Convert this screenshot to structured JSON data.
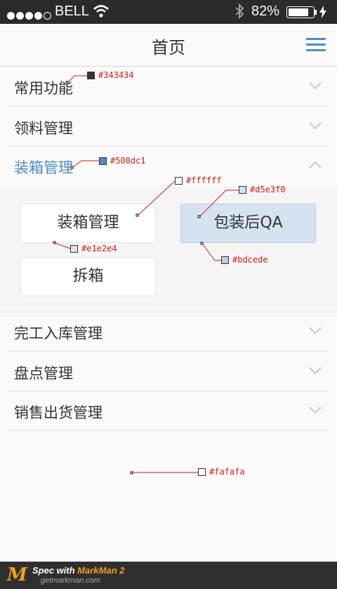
{
  "status_bar": {
    "carrier": "BELL",
    "signal_bars": 4,
    "battery_percent": "82%",
    "battery_level": 0.82,
    "icons": [
      "signal-dots-icon",
      "wifi-icon",
      "bluetooth-icon",
      "battery-icon",
      "charging-bolt-icon"
    ]
  },
  "nav": {
    "title": "首页",
    "menu_icon": "hamburger-menu-icon",
    "accent_color": "#508dc1"
  },
  "accordion": [
    {
      "label": "常用功能",
      "state": "collapsed"
    },
    {
      "label": "领料管理",
      "state": "collapsed"
    },
    {
      "label": "装箱管理",
      "state": "expanded",
      "sub_items": [
        {
          "label": "装箱管理",
          "selected": false
        },
        {
          "label": "包装后QA",
          "selected": true
        },
        {
          "label": "拆箱",
          "selected": false
        }
      ]
    },
    {
      "label": "完工入库管理",
      "state": "collapsed"
    },
    {
      "label": "盘点管理",
      "state": "collapsed"
    },
    {
      "label": "销售出货管理",
      "state": "collapsed"
    }
  ],
  "annotations": {
    "text_color": "#343434",
    "accent": "#508dc1",
    "button_bg": "#ffffff",
    "selected_bg": "#d5e3f0",
    "button_border": "#e1e2e4",
    "selected_border": "#bdcede",
    "page_bg": "#fafafa"
  },
  "footer": {
    "logo_mark": "M",
    "spec_with": "Spec with ",
    "product": "MarkMan 2",
    "site": "getmarkman.com"
  }
}
